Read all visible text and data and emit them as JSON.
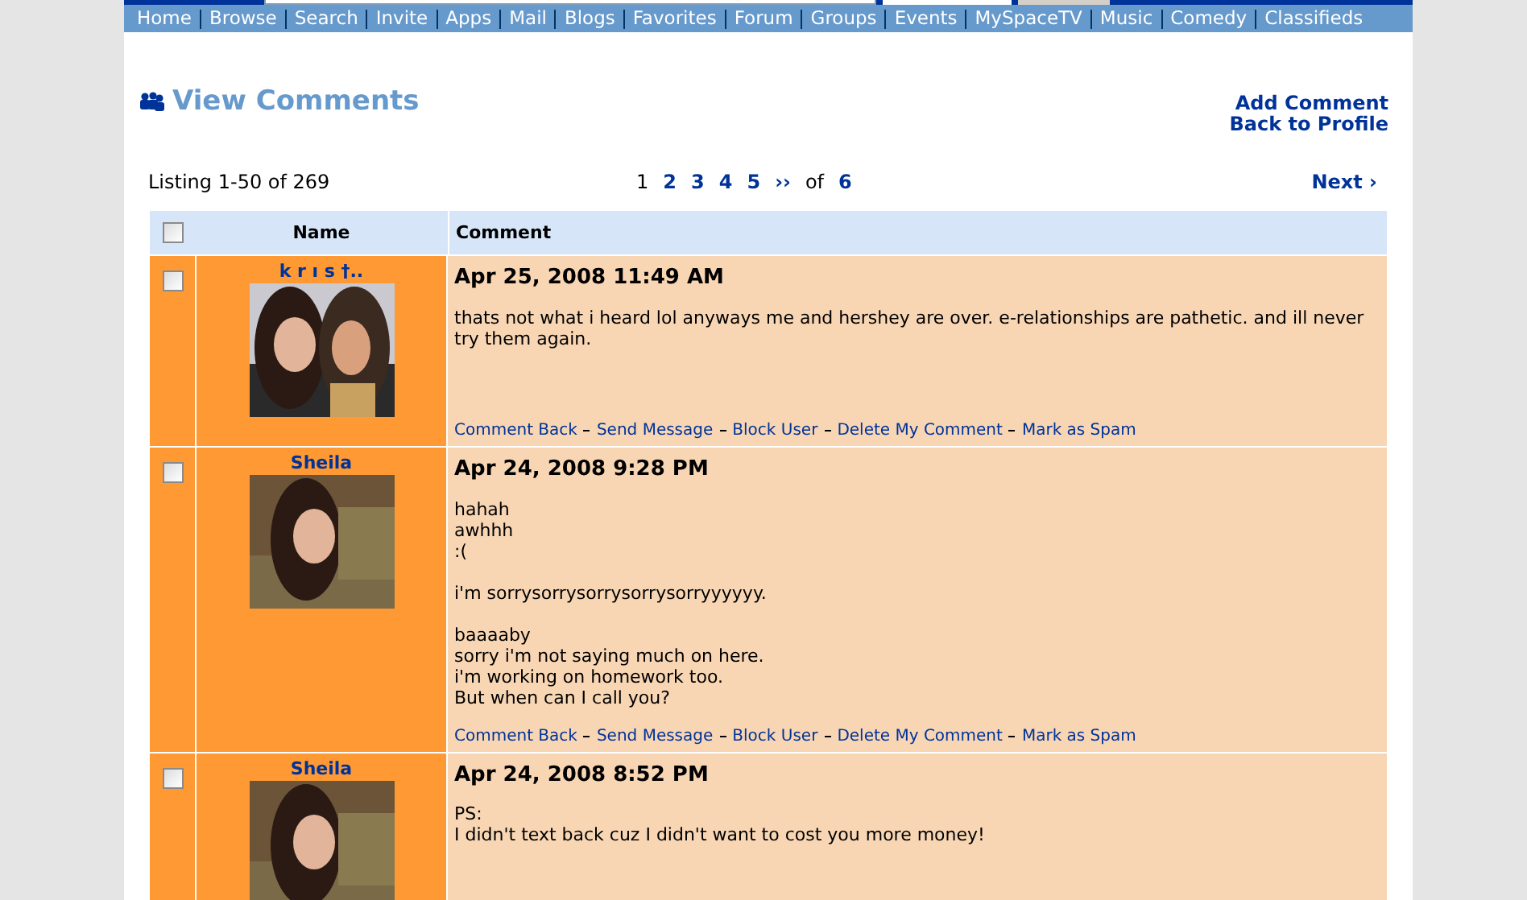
{
  "nav": [
    "Home",
    "Browse",
    "Search",
    "Invite",
    "Apps",
    "Mail",
    "Blogs",
    "Favorites",
    "Forum",
    "Groups",
    "Events",
    "MySpaceTV",
    "Music",
    "Comedy",
    "Classifieds"
  ],
  "title": "View Comments",
  "actions": [
    "Add Comment",
    "Back to Profile"
  ],
  "listing": "Listing 1-50 of 269",
  "pages": [
    {
      "label": "1",
      "selected": true
    },
    {
      "label": "2",
      "selected": false
    },
    {
      "label": "3",
      "selected": false
    },
    {
      "label": "4",
      "selected": false
    },
    {
      "label": "5",
      "selected": false
    }
  ],
  "more": "››",
  "of": "of",
  "last_page": "6",
  "next": "Next ›",
  "table": {
    "select_all": {
      "checked": false
    },
    "columns": [
      "Name",
      "Comment"
    ],
    "rows": [
      {
        "checked": false,
        "name": "k r ı s †..",
        "date": "Apr 25, 2008 11:49 AM",
        "paragraphs": [
          [
            "thats not what i heard lol anyways me and hershey are over. e-relationships are pathetic. and ill never try them again."
          ]
        ],
        "links": [
          "Comment Back",
          "Send Message",
          "Block User",
          "Delete My Comment",
          "Mark as Spam"
        ]
      },
      {
        "checked": false,
        "name": "Sheila",
        "date": "Apr 24, 2008 9:28 PM",
        "paragraphs": [
          [
            "hahah",
            "awhhh",
            ":("
          ],
          [
            "i'm sorrysorrysorrysorrysorryyyyyy."
          ],
          [
            "baaaaby",
            "sorry i'm not saying much on here.",
            "i'm working on homework too.",
            "But when can I call you?"
          ]
        ],
        "links": [
          "Comment Back",
          "Send Message",
          "Block User",
          "Delete My Comment",
          "Mark as Spam"
        ]
      },
      {
        "checked": false,
        "name": "Sheila",
        "date": "Apr 24, 2008 8:52 PM",
        "paragraphs": [
          [
            "PS:",
            "I didn't text back cuz I didn't want to cost you more money!"
          ]
        ],
        "links": []
      }
    ]
  }
}
